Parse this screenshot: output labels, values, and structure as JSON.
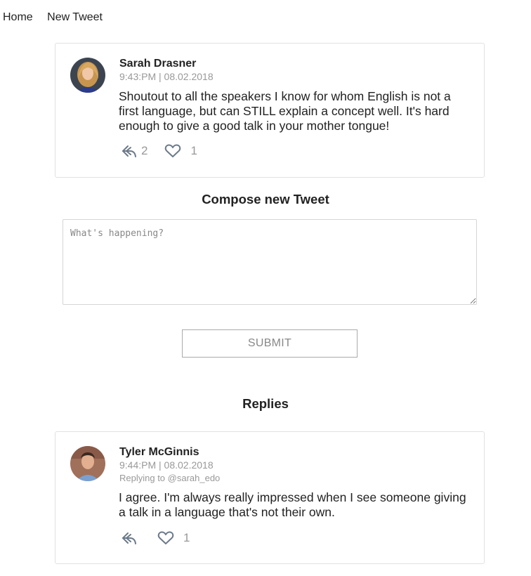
{
  "nav": {
    "home": "Home",
    "new_tweet": "New Tweet"
  },
  "tweet": {
    "author": "Sarah Drasner",
    "meta": "9:43:PM | 08.02.2018",
    "text": "Shoutout to all the speakers I know for whom English is not a first language, but can STILL explain a concept well. It's hard enough to give a good talk in your mother tongue!",
    "reply_count": "2",
    "like_count": "1"
  },
  "compose": {
    "title": "Compose new Tweet",
    "placeholder": "What's happening?",
    "value": "",
    "submit_label": "SUBMIT"
  },
  "replies": {
    "title": "Replies",
    "items": [
      {
        "author": "Tyler McGinnis",
        "meta": "9:44:PM | 08.02.2018",
        "replying_to": "Replying to @sarah_edo",
        "text": "I agree. I'm always really impressed when I see someone giving a talk in a language that's not their own.",
        "like_count": "1"
      }
    ]
  },
  "colors": {
    "muted": "#999999",
    "border": "#e1e1e1",
    "text": "#222222"
  }
}
